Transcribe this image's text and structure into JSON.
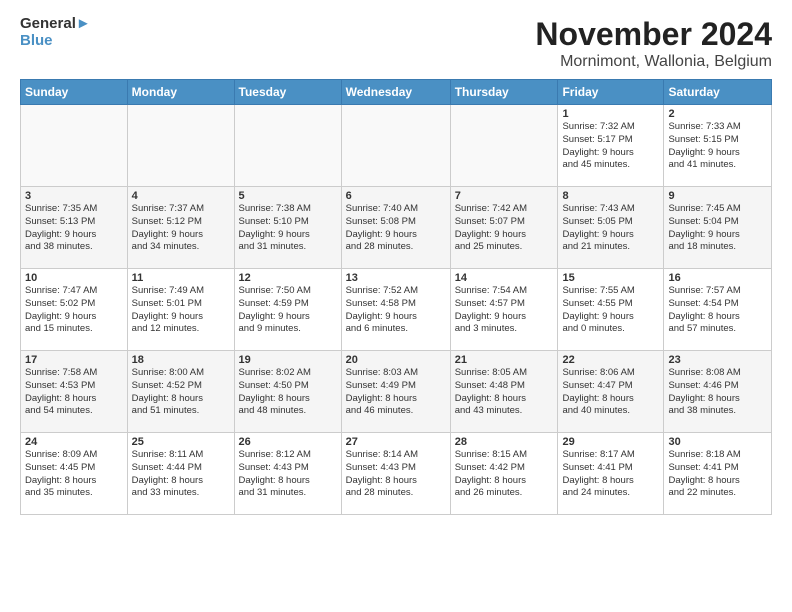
{
  "logo": {
    "line1": "General",
    "line2": "Blue"
  },
  "title": "November 2024",
  "subtitle": "Mornimont, Wallonia, Belgium",
  "weekdays": [
    "Sunday",
    "Monday",
    "Tuesday",
    "Wednesday",
    "Thursday",
    "Friday",
    "Saturday"
  ],
  "weeks": [
    [
      {
        "day": "",
        "info": ""
      },
      {
        "day": "",
        "info": ""
      },
      {
        "day": "",
        "info": ""
      },
      {
        "day": "",
        "info": ""
      },
      {
        "day": "",
        "info": ""
      },
      {
        "day": "1",
        "info": "Sunrise: 7:32 AM\nSunset: 5:17 PM\nDaylight: 9 hours\nand 45 minutes."
      },
      {
        "day": "2",
        "info": "Sunrise: 7:33 AM\nSunset: 5:15 PM\nDaylight: 9 hours\nand 41 minutes."
      }
    ],
    [
      {
        "day": "3",
        "info": "Sunrise: 7:35 AM\nSunset: 5:13 PM\nDaylight: 9 hours\nand 38 minutes."
      },
      {
        "day": "4",
        "info": "Sunrise: 7:37 AM\nSunset: 5:12 PM\nDaylight: 9 hours\nand 34 minutes."
      },
      {
        "day": "5",
        "info": "Sunrise: 7:38 AM\nSunset: 5:10 PM\nDaylight: 9 hours\nand 31 minutes."
      },
      {
        "day": "6",
        "info": "Sunrise: 7:40 AM\nSunset: 5:08 PM\nDaylight: 9 hours\nand 28 minutes."
      },
      {
        "day": "7",
        "info": "Sunrise: 7:42 AM\nSunset: 5:07 PM\nDaylight: 9 hours\nand 25 minutes."
      },
      {
        "day": "8",
        "info": "Sunrise: 7:43 AM\nSunset: 5:05 PM\nDaylight: 9 hours\nand 21 minutes."
      },
      {
        "day": "9",
        "info": "Sunrise: 7:45 AM\nSunset: 5:04 PM\nDaylight: 9 hours\nand 18 minutes."
      }
    ],
    [
      {
        "day": "10",
        "info": "Sunrise: 7:47 AM\nSunset: 5:02 PM\nDaylight: 9 hours\nand 15 minutes."
      },
      {
        "day": "11",
        "info": "Sunrise: 7:49 AM\nSunset: 5:01 PM\nDaylight: 9 hours\nand 12 minutes."
      },
      {
        "day": "12",
        "info": "Sunrise: 7:50 AM\nSunset: 4:59 PM\nDaylight: 9 hours\nand 9 minutes."
      },
      {
        "day": "13",
        "info": "Sunrise: 7:52 AM\nSunset: 4:58 PM\nDaylight: 9 hours\nand 6 minutes."
      },
      {
        "day": "14",
        "info": "Sunrise: 7:54 AM\nSunset: 4:57 PM\nDaylight: 9 hours\nand 3 minutes."
      },
      {
        "day": "15",
        "info": "Sunrise: 7:55 AM\nSunset: 4:55 PM\nDaylight: 9 hours\nand 0 minutes."
      },
      {
        "day": "16",
        "info": "Sunrise: 7:57 AM\nSunset: 4:54 PM\nDaylight: 8 hours\nand 57 minutes."
      }
    ],
    [
      {
        "day": "17",
        "info": "Sunrise: 7:58 AM\nSunset: 4:53 PM\nDaylight: 8 hours\nand 54 minutes."
      },
      {
        "day": "18",
        "info": "Sunrise: 8:00 AM\nSunset: 4:52 PM\nDaylight: 8 hours\nand 51 minutes."
      },
      {
        "day": "19",
        "info": "Sunrise: 8:02 AM\nSunset: 4:50 PM\nDaylight: 8 hours\nand 48 minutes."
      },
      {
        "day": "20",
        "info": "Sunrise: 8:03 AM\nSunset: 4:49 PM\nDaylight: 8 hours\nand 46 minutes."
      },
      {
        "day": "21",
        "info": "Sunrise: 8:05 AM\nSunset: 4:48 PM\nDaylight: 8 hours\nand 43 minutes."
      },
      {
        "day": "22",
        "info": "Sunrise: 8:06 AM\nSunset: 4:47 PM\nDaylight: 8 hours\nand 40 minutes."
      },
      {
        "day": "23",
        "info": "Sunrise: 8:08 AM\nSunset: 4:46 PM\nDaylight: 8 hours\nand 38 minutes."
      }
    ],
    [
      {
        "day": "24",
        "info": "Sunrise: 8:09 AM\nSunset: 4:45 PM\nDaylight: 8 hours\nand 35 minutes."
      },
      {
        "day": "25",
        "info": "Sunrise: 8:11 AM\nSunset: 4:44 PM\nDaylight: 8 hours\nand 33 minutes."
      },
      {
        "day": "26",
        "info": "Sunrise: 8:12 AM\nSunset: 4:43 PM\nDaylight: 8 hours\nand 31 minutes."
      },
      {
        "day": "27",
        "info": "Sunrise: 8:14 AM\nSunset: 4:43 PM\nDaylight: 8 hours\nand 28 minutes."
      },
      {
        "day": "28",
        "info": "Sunrise: 8:15 AM\nSunset: 4:42 PM\nDaylight: 8 hours\nand 26 minutes."
      },
      {
        "day": "29",
        "info": "Sunrise: 8:17 AM\nSunset: 4:41 PM\nDaylight: 8 hours\nand 24 minutes."
      },
      {
        "day": "30",
        "info": "Sunrise: 8:18 AM\nSunset: 4:41 PM\nDaylight: 8 hours\nand 22 minutes."
      }
    ]
  ]
}
